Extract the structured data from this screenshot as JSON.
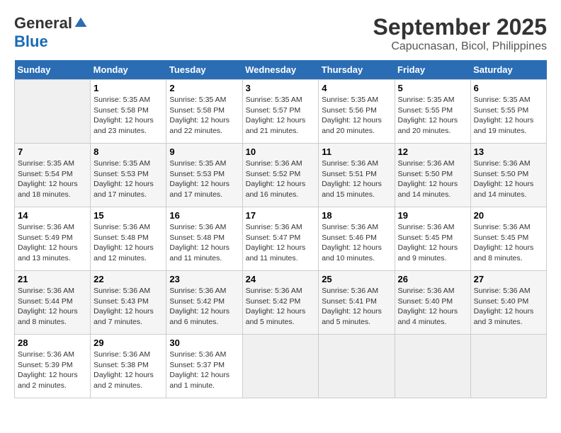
{
  "logo": {
    "general": "General",
    "blue": "Blue"
  },
  "header": {
    "month": "September 2025",
    "location": "Capucnasan, Bicol, Philippines"
  },
  "days": [
    "Sunday",
    "Monday",
    "Tuesday",
    "Wednesday",
    "Thursday",
    "Friday",
    "Saturday"
  ],
  "weeks": [
    [
      {
        "day": "",
        "content": ""
      },
      {
        "day": "1",
        "content": "Sunrise: 5:35 AM\nSunset: 5:58 PM\nDaylight: 12 hours\nand 23 minutes."
      },
      {
        "day": "2",
        "content": "Sunrise: 5:35 AM\nSunset: 5:58 PM\nDaylight: 12 hours\nand 22 minutes."
      },
      {
        "day": "3",
        "content": "Sunrise: 5:35 AM\nSunset: 5:57 PM\nDaylight: 12 hours\nand 21 minutes."
      },
      {
        "day": "4",
        "content": "Sunrise: 5:35 AM\nSunset: 5:56 PM\nDaylight: 12 hours\nand 20 minutes."
      },
      {
        "day": "5",
        "content": "Sunrise: 5:35 AM\nSunset: 5:55 PM\nDaylight: 12 hours\nand 20 minutes."
      },
      {
        "day": "6",
        "content": "Sunrise: 5:35 AM\nSunset: 5:55 PM\nDaylight: 12 hours\nand 19 minutes."
      }
    ],
    [
      {
        "day": "7",
        "content": "Sunrise: 5:35 AM\nSunset: 5:54 PM\nDaylight: 12 hours\nand 18 minutes."
      },
      {
        "day": "8",
        "content": "Sunrise: 5:35 AM\nSunset: 5:53 PM\nDaylight: 12 hours\nand 17 minutes."
      },
      {
        "day": "9",
        "content": "Sunrise: 5:35 AM\nSunset: 5:53 PM\nDaylight: 12 hours\nand 17 minutes."
      },
      {
        "day": "10",
        "content": "Sunrise: 5:36 AM\nSunset: 5:52 PM\nDaylight: 12 hours\nand 16 minutes."
      },
      {
        "day": "11",
        "content": "Sunrise: 5:36 AM\nSunset: 5:51 PM\nDaylight: 12 hours\nand 15 minutes."
      },
      {
        "day": "12",
        "content": "Sunrise: 5:36 AM\nSunset: 5:50 PM\nDaylight: 12 hours\nand 14 minutes."
      },
      {
        "day": "13",
        "content": "Sunrise: 5:36 AM\nSunset: 5:50 PM\nDaylight: 12 hours\nand 14 minutes."
      }
    ],
    [
      {
        "day": "14",
        "content": "Sunrise: 5:36 AM\nSunset: 5:49 PM\nDaylight: 12 hours\nand 13 minutes."
      },
      {
        "day": "15",
        "content": "Sunrise: 5:36 AM\nSunset: 5:48 PM\nDaylight: 12 hours\nand 12 minutes."
      },
      {
        "day": "16",
        "content": "Sunrise: 5:36 AM\nSunset: 5:48 PM\nDaylight: 12 hours\nand 11 minutes."
      },
      {
        "day": "17",
        "content": "Sunrise: 5:36 AM\nSunset: 5:47 PM\nDaylight: 12 hours\nand 11 minutes."
      },
      {
        "day": "18",
        "content": "Sunrise: 5:36 AM\nSunset: 5:46 PM\nDaylight: 12 hours\nand 10 minutes."
      },
      {
        "day": "19",
        "content": "Sunrise: 5:36 AM\nSunset: 5:45 PM\nDaylight: 12 hours\nand 9 minutes."
      },
      {
        "day": "20",
        "content": "Sunrise: 5:36 AM\nSunset: 5:45 PM\nDaylight: 12 hours\nand 8 minutes."
      }
    ],
    [
      {
        "day": "21",
        "content": "Sunrise: 5:36 AM\nSunset: 5:44 PM\nDaylight: 12 hours\nand 8 minutes."
      },
      {
        "day": "22",
        "content": "Sunrise: 5:36 AM\nSunset: 5:43 PM\nDaylight: 12 hours\nand 7 minutes."
      },
      {
        "day": "23",
        "content": "Sunrise: 5:36 AM\nSunset: 5:42 PM\nDaylight: 12 hours\nand 6 minutes."
      },
      {
        "day": "24",
        "content": "Sunrise: 5:36 AM\nSunset: 5:42 PM\nDaylight: 12 hours\nand 5 minutes."
      },
      {
        "day": "25",
        "content": "Sunrise: 5:36 AM\nSunset: 5:41 PM\nDaylight: 12 hours\nand 5 minutes."
      },
      {
        "day": "26",
        "content": "Sunrise: 5:36 AM\nSunset: 5:40 PM\nDaylight: 12 hours\nand 4 minutes."
      },
      {
        "day": "27",
        "content": "Sunrise: 5:36 AM\nSunset: 5:40 PM\nDaylight: 12 hours\nand 3 minutes."
      }
    ],
    [
      {
        "day": "28",
        "content": "Sunrise: 5:36 AM\nSunset: 5:39 PM\nDaylight: 12 hours\nand 2 minutes."
      },
      {
        "day": "29",
        "content": "Sunrise: 5:36 AM\nSunset: 5:38 PM\nDaylight: 12 hours\nand 2 minutes."
      },
      {
        "day": "30",
        "content": "Sunrise: 5:36 AM\nSunset: 5:37 PM\nDaylight: 12 hours\nand 1 minute."
      },
      {
        "day": "",
        "content": ""
      },
      {
        "day": "",
        "content": ""
      },
      {
        "day": "",
        "content": ""
      },
      {
        "day": "",
        "content": ""
      }
    ]
  ]
}
